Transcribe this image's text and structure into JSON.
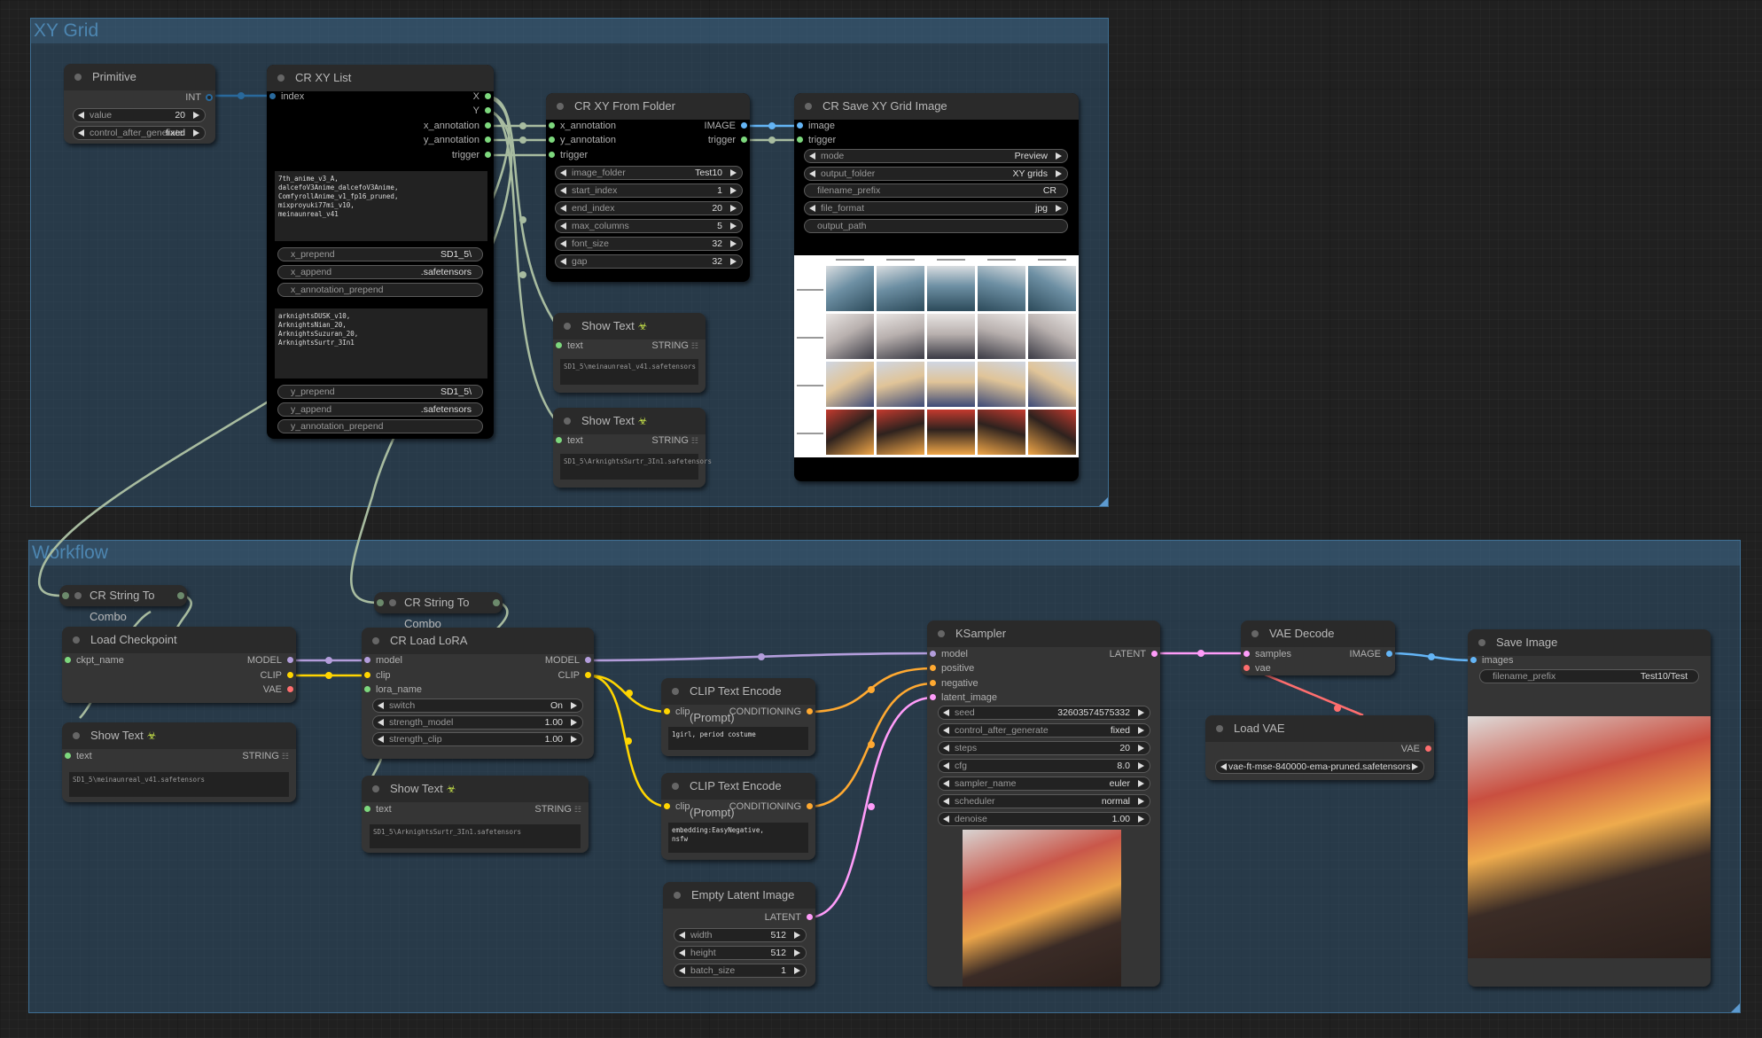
{
  "colors": {
    "model": "#b39ddb",
    "clip": "#ffd500",
    "vae": "#ff6e6e",
    "conditioning": "#ffa931",
    "latent": "#ff9cf9",
    "image": "#64b5f6",
    "int": "#29699c",
    "string": "#7dd87d",
    "generic": "#a8bca0"
  },
  "groups": {
    "xy_grid": {
      "title": "XY Grid"
    },
    "workflow": {
      "title": "Workflow"
    }
  },
  "primitive": {
    "title": "Primitive",
    "output": "INT",
    "widgets": [
      {
        "label": "value",
        "value": "20"
      },
      {
        "label": "control_after_generate",
        "value": "fixed"
      }
    ]
  },
  "xy_list": {
    "title": "CR XY List",
    "input": "index",
    "outputs": [
      "X",
      "Y",
      "x_annotation",
      "y_annotation",
      "trigger"
    ],
    "x_list": "7th_anime_v3_A,\ndalcefoV3Anime_dalcefoV3Anime,\nComfyrollAnime_v1_fp16_pruned,\nmixproyuki77mi_v10,\nmeinaunreal_v41",
    "x_widgets": [
      {
        "label": "x_prepend",
        "value": "SD1_5\\"
      },
      {
        "label": "x_append",
        "value": ".safetensors"
      },
      {
        "label": "x_annotation_prepend",
        "value": ""
      }
    ],
    "y_list": "arknightsDUSK_v10,\nArknightsNian_20,\nArknightsSuzuran_20,\nArknightsSurtr_3In1",
    "y_widgets": [
      {
        "label": "y_prepend",
        "value": "SD1_5\\"
      },
      {
        "label": "y_append",
        "value": ".safetensors"
      },
      {
        "label": "y_annotation_prepend",
        "value": ""
      }
    ]
  },
  "xy_folder": {
    "title": "CR XY From Folder",
    "inputs": [
      "x_annotation",
      "y_annotation",
      "trigger"
    ],
    "outputs": [
      "IMAGE",
      "trigger"
    ],
    "widgets": [
      {
        "label": "image_folder",
        "value": "Test10"
      },
      {
        "label": "start_index",
        "value": "1"
      },
      {
        "label": "end_index",
        "value": "20"
      },
      {
        "label": "max_columns",
        "value": "5"
      },
      {
        "label": "font_size",
        "value": "32"
      },
      {
        "label": "gap",
        "value": "32"
      }
    ]
  },
  "save_xy": {
    "title": "CR Save XY Grid Image",
    "inputs": [
      "image",
      "trigger"
    ],
    "widgets": [
      {
        "label": "mode",
        "value": "Preview"
      },
      {
        "label": "output_folder",
        "value": "XY grids"
      },
      {
        "label": "filename_prefix",
        "value": "CR"
      },
      {
        "label": "file_format",
        "value": "jpg"
      },
      {
        "label": "output_path",
        "value": ""
      }
    ],
    "grid_rows": 4,
    "grid_cols": 5
  },
  "show_text_1": {
    "title": "Show Text",
    "input": "text",
    "output": "STRING",
    "value": "SD1_5\\meinaunreal_v41.safetensors"
  },
  "show_text_2": {
    "title": "Show Text",
    "input": "text",
    "output": "STRING",
    "value": "SD1_5\\ArknightsSurtr_3In1.safetensors"
  },
  "string_combo_1": {
    "title": "CR String To Combo"
  },
  "string_combo_2": {
    "title": "CR String To Combo"
  },
  "load_checkpoint": {
    "title": "Load Checkpoint",
    "input": "ckpt_name",
    "outputs": [
      "MODEL",
      "CLIP",
      "VAE"
    ]
  },
  "show_text_3": {
    "title": "Show Text",
    "input": "text",
    "output": "STRING",
    "value": "SD1_5\\meinaunreal_v41.safetensors"
  },
  "load_lora": {
    "title": "CR Load LoRA",
    "inputs": [
      "model",
      "clip",
      "lora_name"
    ],
    "outputs": [
      "MODEL",
      "CLIP"
    ],
    "widgets": [
      {
        "label": "switch",
        "value": "On"
      },
      {
        "label": "strength_model",
        "value": "1.00"
      },
      {
        "label": "strength_clip",
        "value": "1.00"
      }
    ]
  },
  "show_text_4": {
    "title": "Show Text",
    "input": "text",
    "output": "STRING",
    "value": "SD1_5\\ArknightsSurtr_3In1.safetensors"
  },
  "clip_pos": {
    "title": "CLIP Text Encode (Prompt)",
    "input": "clip",
    "output": "CONDITIONING",
    "text": "1girl, period costume"
  },
  "clip_neg": {
    "title": "CLIP Text Encode (Prompt)",
    "input": "clip",
    "output": "CONDITIONING",
    "text": "embedding:EasyNegative,\nnsfw"
  },
  "empty_latent": {
    "title": "Empty Latent Image",
    "output": "LATENT",
    "widgets": [
      {
        "label": "width",
        "value": "512"
      },
      {
        "label": "height",
        "value": "512"
      },
      {
        "label": "batch_size",
        "value": "1"
      }
    ]
  },
  "ksampler": {
    "title": "KSampler",
    "inputs": [
      "model",
      "positive",
      "negative",
      "latent_image"
    ],
    "output": "LATENT",
    "widgets": [
      {
        "label": "seed",
        "value": "32603574575332"
      },
      {
        "label": "control_after_generate",
        "value": "fixed"
      },
      {
        "label": "steps",
        "value": "20"
      },
      {
        "label": "cfg",
        "value": "8.0"
      },
      {
        "label": "sampler_name",
        "value": "euler"
      },
      {
        "label": "scheduler",
        "value": "normal"
      },
      {
        "label": "denoise",
        "value": "1.00"
      }
    ]
  },
  "vae_decode": {
    "title": "VAE Decode",
    "inputs": [
      "samples",
      "vae"
    ],
    "output": "IMAGE"
  },
  "load_vae": {
    "title": "Load VAE",
    "output": "VAE",
    "widget_value": "vae-ft-mse-840000-ema-pruned.safetensors"
  },
  "save_image": {
    "title": "Save Image",
    "input": "images",
    "widgets": [
      {
        "label": "filename_prefix",
        "value": "Test10/Test"
      }
    ]
  }
}
